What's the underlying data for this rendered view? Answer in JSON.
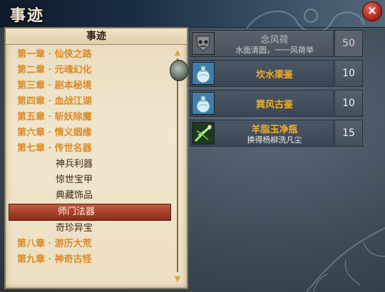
{
  "window": {
    "title": "事迹",
    "close_label": "×"
  },
  "panel": {
    "header": "事迹"
  },
  "list": [
    {
      "label": "第一章 · 仙侠之路",
      "type": "chapter",
      "selected": false
    },
    {
      "label": "第二章 · 元魂幻化",
      "type": "chapter",
      "selected": false
    },
    {
      "label": "第三章 · 剧本秘境",
      "type": "chapter",
      "selected": false
    },
    {
      "label": "第四章 · 血战江湖",
      "type": "chapter",
      "selected": false
    },
    {
      "label": "第五章 · 斩妖除魔",
      "type": "chapter",
      "selected": false
    },
    {
      "label": "第六章 · 情义姻缘",
      "type": "chapter",
      "selected": false
    },
    {
      "label": "第七章 · 传世名器",
      "type": "chapter",
      "selected": false
    },
    {
      "label": "神兵利器",
      "type": "sub",
      "selected": false
    },
    {
      "label": "惊世宝甲",
      "type": "sub",
      "selected": false
    },
    {
      "label": "典藏饰品",
      "type": "sub",
      "selected": false
    },
    {
      "label": "师门法器",
      "type": "sub",
      "selected": true
    },
    {
      "label": "奇珍异宝",
      "type": "sub",
      "selected": false
    },
    {
      "label": "第八章 · 游历大荒",
      "type": "chapter",
      "selected": false
    },
    {
      "label": "第九章 · 神奇古怪",
      "type": "chapter",
      "selected": false
    }
  ],
  "scrollbar": {
    "up_icon": "▲",
    "down_icon": "▼",
    "position": 0.0
  },
  "rewards": [
    {
      "name": "念风荷",
      "desc": "水面清圆，一一风荷举",
      "qty": "50",
      "icon": "shield-mask-icon",
      "dim": true
    },
    {
      "name": "坎水渠鉴",
      "desc": "",
      "qty": "10",
      "icon": "gourd-vase-icon",
      "dim": false
    },
    {
      "name": "巽风古鉴",
      "desc": "",
      "qty": "10",
      "icon": "gourd-vase-icon",
      "dim": false
    },
    {
      "name": "羊脂玉净瓶",
      "desc": "换得杨柳洗凡尘",
      "qty": "15",
      "icon": "green-willow-icon",
      "dim": false
    }
  ],
  "colors": {
    "chapter_text": "#d98a26",
    "selected_bg": "#8a2c1c",
    "item_name": "#f2ad2c"
  }
}
